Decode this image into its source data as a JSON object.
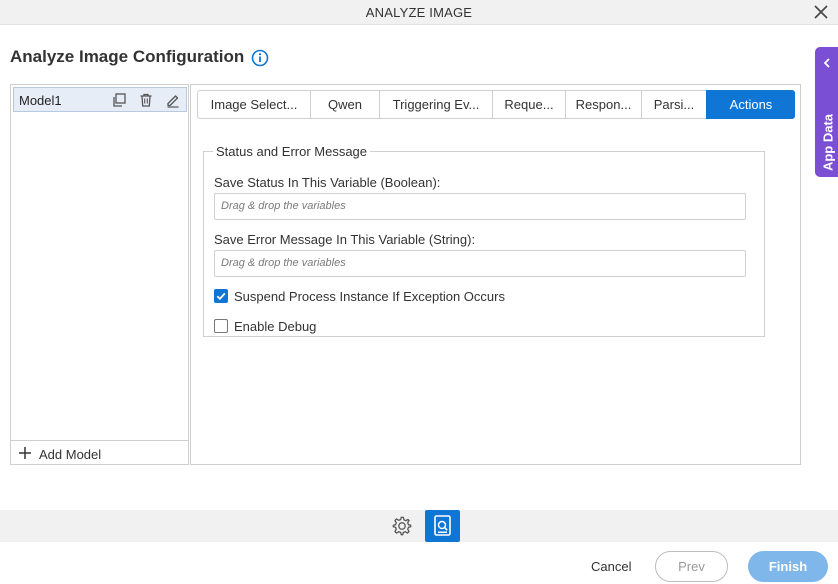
{
  "window": {
    "title": "ANALYZE IMAGE"
  },
  "page": {
    "heading": "Analyze Image Configuration"
  },
  "models": {
    "items": [
      {
        "label": "Model1"
      }
    ],
    "add_label": "Add Model"
  },
  "tabs": [
    {
      "label": "Image Select..."
    },
    {
      "label": "Qwen"
    },
    {
      "label": "Triggering Ev..."
    },
    {
      "label": "Reque..."
    },
    {
      "label": "Respon..."
    },
    {
      "label": "Parsi..."
    },
    {
      "label": "Actions",
      "active": true
    }
  ],
  "status_section": {
    "legend": "Status and Error Message",
    "save_status_label": "Save Status In This Variable (Boolean):",
    "save_status_placeholder": "Drag & drop the variables",
    "save_error_label": "Save Error Message In This Variable (String):",
    "save_error_placeholder": "Drag & drop the variables",
    "suspend_label": "Suspend Process Instance If Exception Occurs",
    "suspend_checked": true,
    "debug_label": "Enable Debug",
    "debug_checked": false
  },
  "footer": {
    "cancel_label": "Cancel",
    "prev_label": "Prev",
    "finish_label": "Finish"
  },
  "side_tab": {
    "label": "App Data"
  },
  "colors": {
    "accent": "#1076d6",
    "side_tab": "#7b4fd3",
    "finish_disabled": "#7fb7ea"
  }
}
